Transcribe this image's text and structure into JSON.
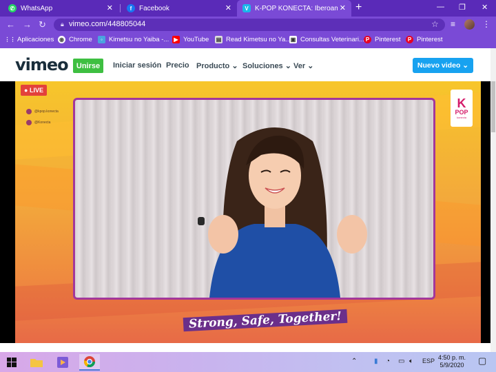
{
  "browser": {
    "tabs": [
      {
        "title": "WhatsApp",
        "icon": "whatsapp-icon",
        "color": "#25d366"
      },
      {
        "title": "Facebook",
        "icon": "facebook-icon",
        "color": "#1877f2"
      },
      {
        "title": "K-POP KONECTA: Iberoamér",
        "icon": "vimeo-icon",
        "color": "#1ab7ea"
      }
    ],
    "url": "vimeo.com/448805044",
    "bookmarks": [
      {
        "label": "Aplicaciones",
        "icon": "apps-grid-icon"
      },
      {
        "label": "Chrome",
        "icon": "chrome-icon"
      },
      {
        "label": "Kimetsu no Yaiba -...",
        "icon": "site-icon"
      },
      {
        "label": "YouTube",
        "icon": "youtube-icon"
      },
      {
        "label": "Read Kimetsu no Ya...",
        "icon": "site-icon"
      },
      {
        "label": "Consultas Veterinari...",
        "icon": "site-icon"
      },
      {
        "label": "Pinterest",
        "icon": "pinterest-icon"
      },
      {
        "label": "Pinterest",
        "icon": "pinterest-icon"
      }
    ]
  },
  "vimeo": {
    "logo": "vimeo",
    "join_label": "Unirse",
    "nav": [
      {
        "label": "Iniciar sesión"
      },
      {
        "label": "Precio"
      },
      {
        "label": "Producto ⌄"
      },
      {
        "label": "Soluciones ⌄"
      },
      {
        "label": "Ver ⌄"
      }
    ],
    "new_video_label": "Nuevo video  ⌄",
    "accent": "#17a2f0",
    "join_color": "#3ebf41"
  },
  "video": {
    "live_label": "● LIVE",
    "social": [
      "@kpop.konecta",
      "@Konecta"
    ],
    "brand_k": "K",
    "brand_pop": "POP",
    "brand_sub": "konecta",
    "slogan": "Strong, Safe, Together!"
  },
  "taskbar": {
    "language": "ESP",
    "time": "4:50 p. m.",
    "date": "5/9/2020"
  }
}
